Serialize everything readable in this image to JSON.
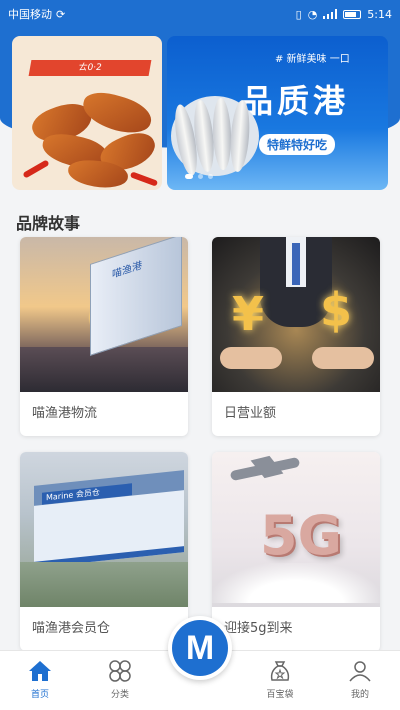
{
  "status_bar": {
    "carrier": "中国移动",
    "time": "5:14"
  },
  "banner": {
    "left": {
      "brand": "ㄊ0·2"
    },
    "right": {
      "tag": "# 新鲜美味 一口",
      "title": "品质港",
      "subtitle": "特鲜特好吃"
    }
  },
  "section": {
    "title": "品牌故事"
  },
  "cards": [
    {
      "label": "喵渔港物流",
      "image_text": "喵渔港"
    },
    {
      "label": "日营业额"
    },
    {
      "label": "喵渔港会员仓",
      "image_text": "Marine 会员仓"
    },
    {
      "label": "迎接5g到来",
      "image_text": "5G"
    }
  ],
  "tabs": [
    {
      "label": "首页",
      "icon": "home-icon"
    },
    {
      "label": "分类",
      "icon": "category-icon"
    },
    {
      "label": "百宝袋",
      "icon": "bag-icon"
    },
    {
      "label": "我的",
      "icon": "profile-icon"
    }
  ],
  "center_button": {
    "letter": "M"
  },
  "colors": {
    "primary": "#1e6fd0"
  }
}
